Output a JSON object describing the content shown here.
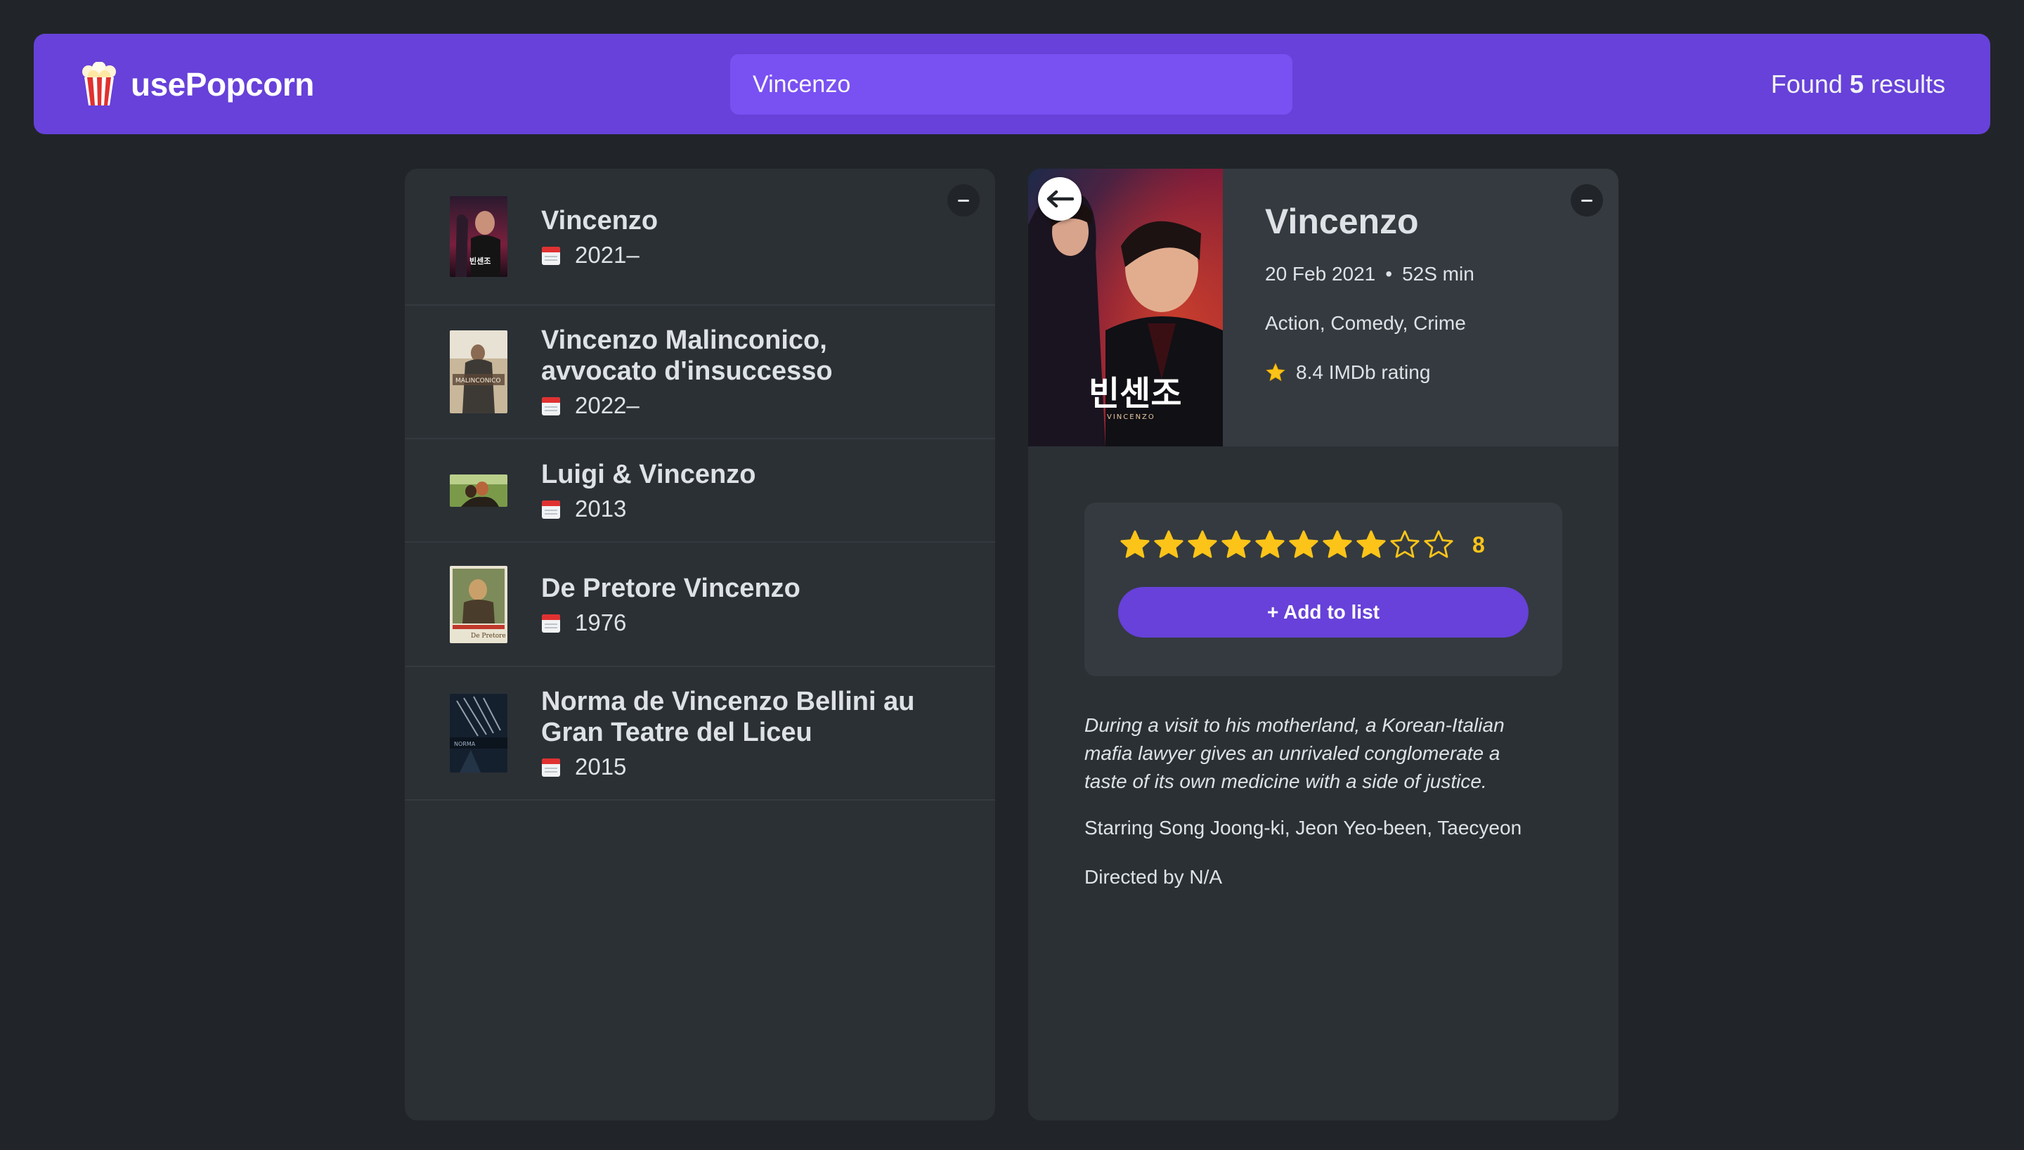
{
  "nav": {
    "logo_text": "usePopcorn",
    "search_value": "Vincenzo",
    "results_prefix": "Found",
    "results_count": "5",
    "results_suffix": "results"
  },
  "movies": [
    {
      "title": "Vincenzo",
      "year": "2021–"
    },
    {
      "title": "Vincenzo Malinconico, avvocato d'insuccesso",
      "year": "2022–"
    },
    {
      "title": "Luigi & Vincenzo",
      "year": "2013"
    },
    {
      "title": "De Pretore Vincenzo",
      "year": "1976"
    },
    {
      "title": "Norma de Vincenzo Bellini au Gran Teatre del Liceu",
      "year": "2015"
    }
  ],
  "details": {
    "title": "Vincenzo",
    "released": "20 Feb 2021",
    "runtime": "52S min",
    "separator": "•",
    "genre": "Action, Comedy, Crime",
    "imdb_rating": "8.4 IMDb rating",
    "user_rating": "8",
    "max_rating": 10,
    "add_button": "+ Add to list",
    "plot": "During a visit to his motherland, a Korean-Italian mafia lawyer gives an unrivaled conglomerate a taste of its own medicine with a side of justice.",
    "starring": "Starring Song Joong-ki, Jeon Yeo-been, Taecyeon",
    "directed": "Directed by N/A",
    "poster_text": "빈센조",
    "poster_subtext": "VINCENZO"
  },
  "colors": {
    "background": "#212529",
    "nav": "#6741d9",
    "search": "#7950f2",
    "box": "#2b3035",
    "accent_star": "#fcc419"
  },
  "icons": {
    "logo": "popcorn-icon",
    "year": "calendar-icon",
    "back": "arrow-left-icon",
    "rating": "star-icon",
    "toggle": "minus-icon"
  }
}
